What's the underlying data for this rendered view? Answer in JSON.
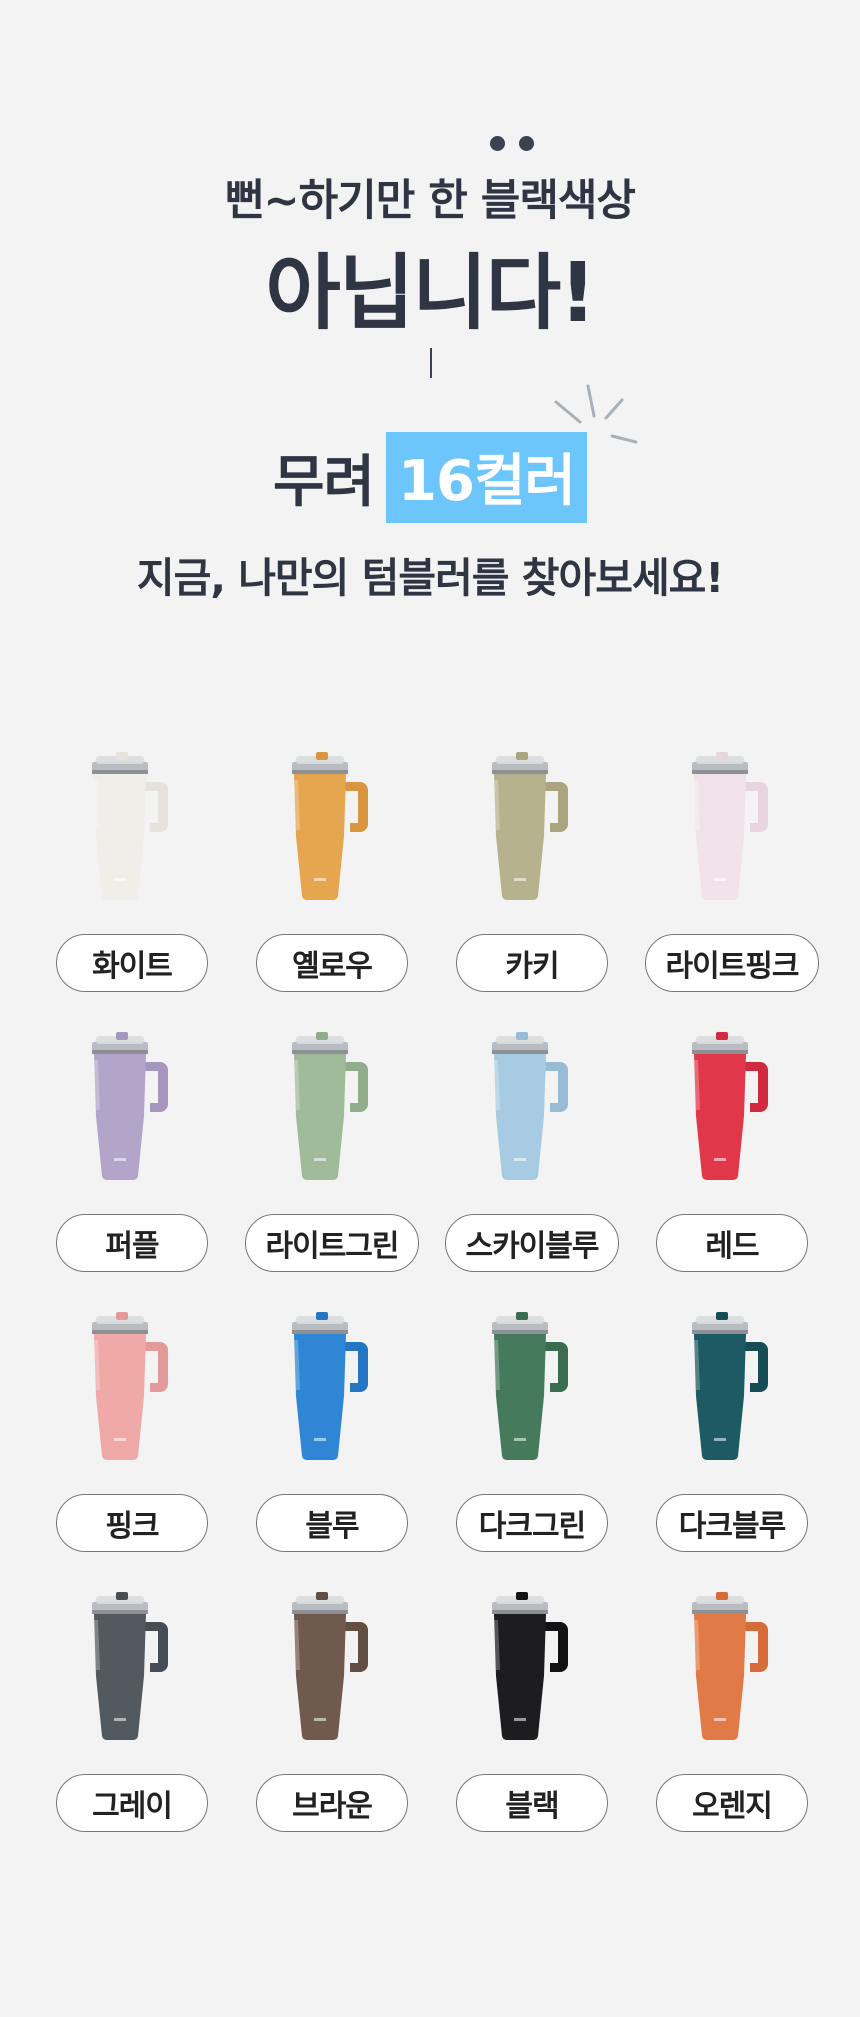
{
  "heading": {
    "line1": "뻔~하기만 한 블랙색상",
    "line2": "아닙니다!",
    "line3_prefix": "무려",
    "line3_highlight": "16컬러",
    "line4": "지금, 나만의 텀블러를 찾아보세요!"
  },
  "colors": [
    {
      "label": "화이트",
      "hex": "#efeee8",
      "handle": "#e5e3dc"
    },
    {
      "label": "옐로우",
      "hex": "#e6a54f",
      "handle": "#d89640"
    },
    {
      "label": "카키",
      "hex": "#b7b28e",
      "handle": "#aaa47f"
    },
    {
      "label": "라이트핑크",
      "hex": "#f0e2e8",
      "handle": "#e8d5dd"
    },
    {
      "label": "퍼플",
      "hex": "#b3a4c9",
      "handle": "#a596bc"
    },
    {
      "label": "라이트그린",
      "hex": "#9fbb99",
      "handle": "#91ad8b"
    },
    {
      "label": "스카이블루",
      "hex": "#a7cbe2",
      "handle": "#98bcd4"
    },
    {
      "label": "레드",
      "hex": "#e0374a",
      "handle": "#cf2a3d"
    },
    {
      "label": "핑크",
      "hex": "#efaaa8",
      "handle": "#e29b99"
    },
    {
      "label": "블루",
      "hex": "#2f86d4",
      "handle": "#2476c2"
    },
    {
      "label": "다크그린",
      "hex": "#467a5c",
      "handle": "#3a6c4f"
    },
    {
      "label": "다크블루",
      "hex": "#1d5a63",
      "handle": "#164d55"
    },
    {
      "label": "그레이",
      "hex": "#525a5f",
      "handle": "#474e53"
    },
    {
      "label": "브라운",
      "hex": "#6f5a4d",
      "handle": "#624e42"
    },
    {
      "label": "블랙",
      "hex": "#1d1d1f",
      "handle": "#121214"
    },
    {
      "label": "오렌지",
      "hex": "#e27a48",
      "handle": "#d66c3a"
    }
  ],
  "accent": "#6cc6fb"
}
